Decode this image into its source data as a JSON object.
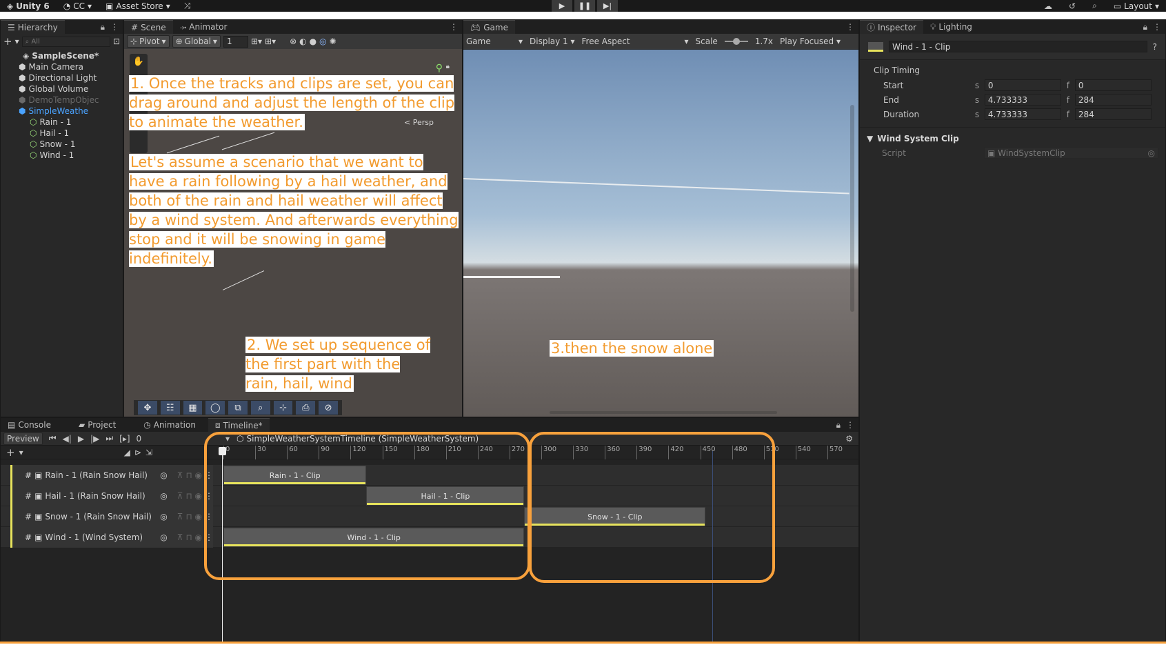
{
  "topbar": {
    "app": "Unity 6",
    "account": "CC",
    "store": "Asset Store",
    "play_icons": [
      "▶",
      "❚❚",
      "▶|"
    ],
    "layout": "Layout"
  },
  "hierarchy": {
    "tab": "Hierarchy",
    "search_placeholder": "All",
    "items": [
      {
        "label": "SampleScene*",
        "depth": 0,
        "icon": "unity-icon",
        "state": "scene"
      },
      {
        "label": "Main Camera",
        "depth": 1,
        "icon": "cube-icon",
        "state": "normal"
      },
      {
        "label": "Directional Light",
        "depth": 1,
        "icon": "cube-icon",
        "state": "normal"
      },
      {
        "label": "Global Volume",
        "depth": 1,
        "icon": "cube-icon",
        "state": "normal"
      },
      {
        "label": "DemoTempObjec",
        "depth": 1,
        "icon": "cube-icon",
        "state": "dim"
      },
      {
        "label": "SimpleWeathe",
        "depth": 1,
        "icon": "prefab-icon",
        "state": "selected"
      },
      {
        "label": "Rain - 1",
        "depth": 2,
        "icon": "gameobject-icon",
        "state": "normal"
      },
      {
        "label": "Hail - 1",
        "depth": 2,
        "icon": "gameobject-icon",
        "state": "normal"
      },
      {
        "label": "Snow - 1",
        "depth": 2,
        "icon": "gameobject-icon",
        "state": "normal"
      },
      {
        "label": "Wind - 1",
        "depth": 2,
        "icon": "gameobject-icon",
        "state": "normal"
      }
    ]
  },
  "scene": {
    "tabs": [
      "Scene",
      "Animator"
    ],
    "pivot": "Pivot",
    "global": "Global",
    "grid_value": "1",
    "persp": "< Persp"
  },
  "game": {
    "tab": "Game",
    "display_mode": "Game",
    "display": "Display 1",
    "aspect": "Free Aspect",
    "scale_label": "Scale",
    "scale_value": "1.7x",
    "play_mode": "Play Focused"
  },
  "inspector": {
    "tabs": [
      "Inspector",
      "Lighting"
    ],
    "object_name": "Wind - 1 - Clip",
    "clip_timing_header": "Clip Timing",
    "rows": [
      {
        "label": "Start",
        "s": "0",
        "f": "0"
      },
      {
        "label": "End",
        "s": "4.733333",
        "f": "284"
      },
      {
        "label": "Duration",
        "s": "4.733333",
        "f": "284"
      }
    ],
    "unit_s": "s",
    "unit_f": "f",
    "component": "Wind System Clip",
    "script_label": "Script",
    "script_value": "WindSystemClip"
  },
  "bottom": {
    "tabs": [
      "Console",
      "Project",
      "Animation",
      "Timeline*"
    ],
    "preview": "Preview",
    "frame": "0",
    "timeline_title": "SimpleWeatherSystemTimeline (SimpleWeatherSystem)",
    "ticks": [
      "0",
      "30",
      "60",
      "90",
      "120",
      "150",
      "180",
      "210",
      "240",
      "270",
      "300",
      "330",
      "360",
      "390",
      "420",
      "450",
      "480",
      "510",
      "540",
      "570"
    ],
    "tracks": [
      {
        "label": "Rain - 1 (Rain Snow Hail)",
        "clip": "Rain - 1 - Clip",
        "start": 0,
        "end": 135
      },
      {
        "label": "Hail - 1 (Rain Snow Hail)",
        "clip": "Hail - 1 - Clip",
        "start": 135,
        "end": 284
      },
      {
        "label": "Snow - 1 (Rain Snow Hail)",
        "clip": "Snow - 1 - Clip",
        "start": 284,
        "end": 455
      },
      {
        "label": "Wind - 1 (Wind System)",
        "clip": "Wind - 1 - Clip",
        "start": 0,
        "end": 284
      }
    ]
  },
  "notes": {
    "n1": "1. Once the tracks and clips are set, you can drag around and adjust the length of the clip to animate the weather.",
    "n2": "Let's assume a scenario that we want to have a rain following by a hail weather, and both of the rain and hail weather will affect by a wind system. And afterwards everything stop and it will be snowing in game indefinitely.",
    "n3": "2. We set up sequence of the first part with the rain, hail, wind",
    "n4": "3.then the snow alone"
  },
  "colors": {
    "accent": "#f8a13c",
    "clip_bar": "#e7e35c",
    "selected": "#4aa3ff"
  }
}
